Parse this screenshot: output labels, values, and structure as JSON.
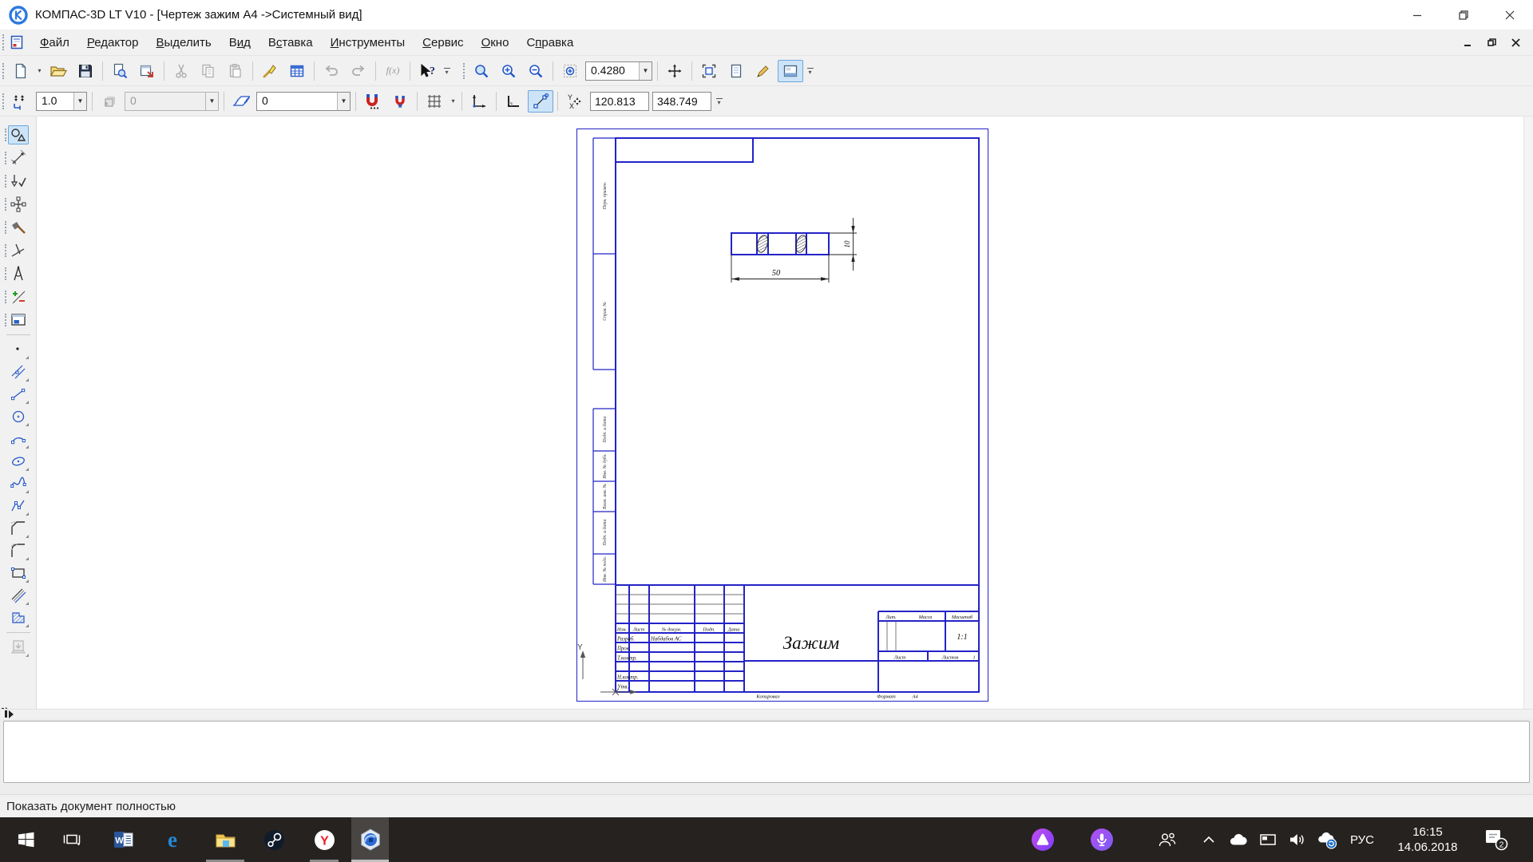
{
  "titlebar": {
    "title": "КОМПАС-3D LT V10 - [Чертеж зажим А4 ->Системный вид]"
  },
  "menu": {
    "items": [
      {
        "label": "Файл",
        "u": 0
      },
      {
        "label": "Редактор",
        "u": 0
      },
      {
        "label": "Выделить",
        "u": 0
      },
      {
        "label": "Вид",
        "u": 1
      },
      {
        "label": "Вставка",
        "u": 1
      },
      {
        "label": "Инструменты",
        "u": 0
      },
      {
        "label": "Сервис",
        "u": 0
      },
      {
        "label": "Окно",
        "u": 0
      },
      {
        "label": "Справка",
        "u": 1
      }
    ]
  },
  "toolbar": {
    "scale": "0.4280",
    "step": "1.0",
    "view_number": "0",
    "layer": "0",
    "coord_x": "120.813",
    "coord_y": "348.749",
    "fx_label": "f(x)",
    "coord_icon_y": "Y",
    "coord_icon_x": "X"
  },
  "sheet": {
    "part_name": "Зажим",
    "dims": {
      "length": "50",
      "height": "10"
    },
    "stamp": {
      "h_izm": "Изм.",
      "h_list": "Лист",
      "h_doc": "№ докум.",
      "h_podp": "Подп.",
      "h_data": "Дата",
      "razrab": "Разраб.",
      "razrab_name": "Набдабов АС",
      "prov": "Пров.",
      "tkontr": "Т.контр.",
      "nkontr": "Н.контр.",
      "utv": "Утв.",
      "lit": "Лит.",
      "massa": "Масса",
      "masshtab": "Масштаб",
      "masshtab_value": "1:1",
      "list": "Лист",
      "listov": "Листов",
      "listov_value": "1",
      "kopiroval": "Копировал",
      "format": "Формат",
      "format_value": "А4"
    },
    "margins": [
      "Перв. примен.",
      "Справ. №",
      "Подп. и дата",
      "Инв. № дубл.",
      "Взам. инв. №",
      "Подп. и дата",
      "Инв. № подл."
    ],
    "axis_y_label": "Y"
  },
  "statusbar": {
    "message": "Показать документ полностью"
  },
  "taskbar": {
    "lang": "РУС",
    "time": "16:15",
    "date": "14.06.2018",
    "badge": "2",
    "icons": {
      "word": "W",
      "edge": "e",
      "yandex": "Y"
    }
  }
}
